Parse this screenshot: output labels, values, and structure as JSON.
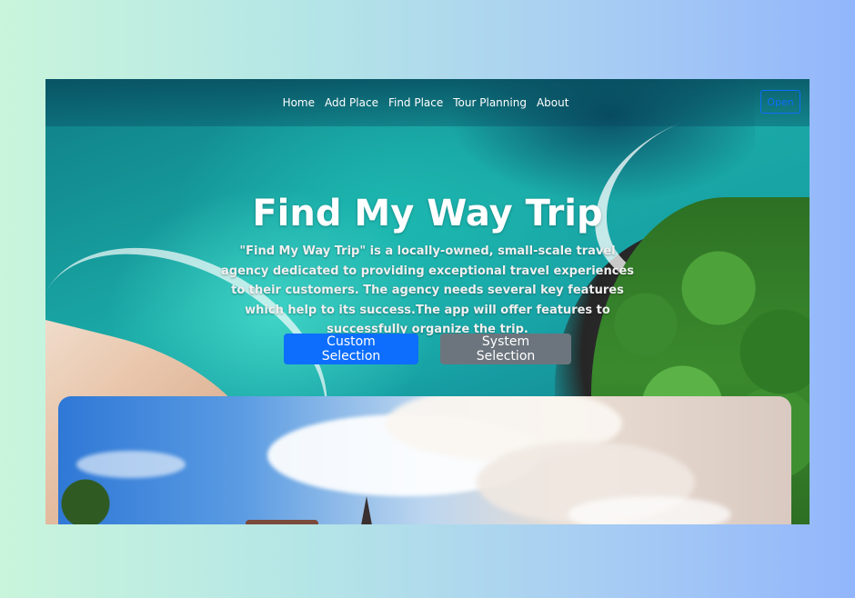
{
  "nav": {
    "links": [
      "Home",
      "Add Place",
      "Find Place",
      "Tour Planning",
      "About"
    ],
    "button_label": "Open"
  },
  "hero": {
    "title": "Find My Way Trip",
    "description": "\"Find My Way Trip\" is a locally-owned, small-scale travel agency dedicated to providing exceptional travel experiences to their customers. The agency needs several key features which help to its success.The app will offer features to successfully organize the trip.",
    "primary_button": "Custom Selection",
    "secondary_button": "System Selection"
  },
  "colors": {
    "primary": "#0d6efd",
    "secondary": "#6c757d",
    "nav_text": "#ffffff"
  }
}
